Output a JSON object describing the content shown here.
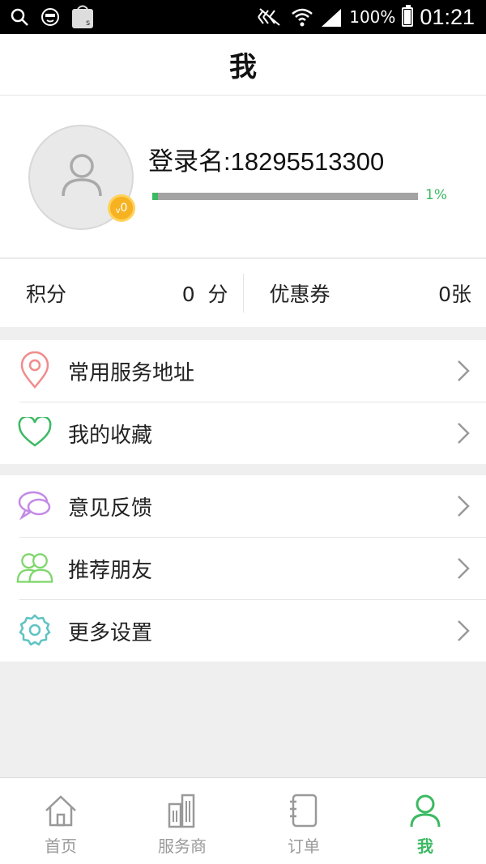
{
  "status_bar": {
    "battery": "100%",
    "time": "01:21"
  },
  "header": {
    "title": "我"
  },
  "profile": {
    "login_name": "登录名:18295513300",
    "level": "0",
    "level_prefix": "v",
    "progress_percent": 1,
    "progress_text": "1%"
  },
  "points": {
    "points_label": "积分",
    "points_value": "0  分",
    "coupons_label": "优惠券",
    "coupons_value": "0张"
  },
  "menu": {
    "group1": [
      {
        "label": "常用服务地址",
        "icon": "location-pin-icon"
      },
      {
        "label": "我的收藏",
        "icon": "heart-icon"
      }
    ],
    "group2": [
      {
        "label": "意见反馈",
        "icon": "chat-bubble-icon"
      },
      {
        "label": "推荐朋友",
        "icon": "friends-icon"
      },
      {
        "label": "更多设置",
        "icon": "gear-icon"
      }
    ]
  },
  "tabs": [
    {
      "label": "首页",
      "icon": "home-icon",
      "active": false
    },
    {
      "label": "服务商",
      "icon": "building-icon",
      "active": false
    },
    {
      "label": "订单",
      "icon": "notebook-icon",
      "active": false
    },
    {
      "label": "我",
      "icon": "person-icon",
      "active": true
    }
  ],
  "colors": {
    "accent": "#3cb963",
    "badge": "#f6b221",
    "pin": "#f08c8c",
    "heart": "#3cb963",
    "chat": "#c389e6",
    "friends": "#7ed66b",
    "gear": "#5fc3c3"
  }
}
